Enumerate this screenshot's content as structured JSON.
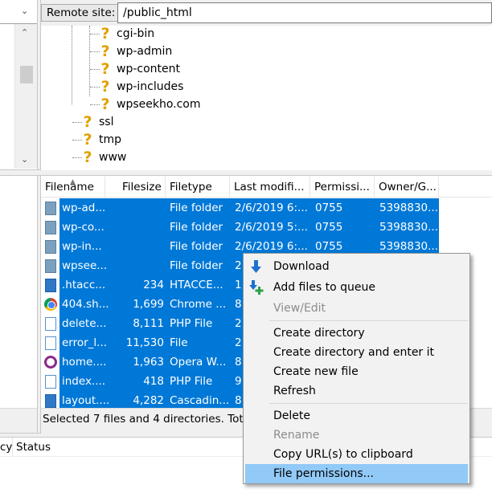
{
  "remote": {
    "site_label": "Remote site:",
    "path": "/public_html"
  },
  "tree": {
    "items": [
      {
        "label": "cgi-bin"
      },
      {
        "label": "wp-admin"
      },
      {
        "label": "wp-content"
      },
      {
        "label": "wp-includes"
      },
      {
        "label": "wpseekho.com"
      },
      {
        "label": "ssl"
      },
      {
        "label": "tmp"
      },
      {
        "label": "www"
      }
    ],
    "icon": "unknown-folder-question-icon"
  },
  "file_list": {
    "columns": [
      "Filename",
      "Filesize",
      "Filetype",
      "Last modifi...",
      "Permissi...",
      "Owner/G..."
    ],
    "rows": [
      {
        "icon": "folder",
        "name": "wp-ad...",
        "size": "",
        "type": "File folder",
        "modified": "2/6/2019 6:...",
        "perms": "0755",
        "owner": "5398830..."
      },
      {
        "icon": "folder",
        "name": "wp-co...",
        "size": "",
        "type": "File folder",
        "modified": "2/6/2019 5:...",
        "perms": "0755",
        "owner": "5398830..."
      },
      {
        "icon": "folder",
        "name": "wp-in...",
        "size": "",
        "type": "File folder",
        "modified": "2/6/2019 6:...",
        "perms": "0755",
        "owner": "5398830..."
      },
      {
        "icon": "folder",
        "name": "wpsee...",
        "size": "",
        "type": "File folder",
        "modified": "2",
        "perms": "",
        "owner": ""
      },
      {
        "icon": "htaccess",
        "name": ".htacc...",
        "size": "234",
        "type": "HTACCE...",
        "modified": "1",
        "perms": "",
        "owner": ""
      },
      {
        "icon": "chrome",
        "name": "404.sh...",
        "size": "1,699",
        "type": "Chrome ...",
        "modified": "8",
        "perms": "",
        "owner": ""
      },
      {
        "icon": "php",
        "name": "delete...",
        "size": "8,111",
        "type": "PHP File",
        "modified": "2",
        "perms": "",
        "owner": ""
      },
      {
        "icon": "file",
        "name": "error_l...",
        "size": "11,530",
        "type": "File",
        "modified": "2",
        "perms": "",
        "owner": ""
      },
      {
        "icon": "opera",
        "name": "home....",
        "size": "1,963",
        "type": "Opera W...",
        "modified": "8",
        "perms": "",
        "owner": ""
      },
      {
        "icon": "php",
        "name": "index....",
        "size": "418",
        "type": "PHP File",
        "modified": "9",
        "perms": "",
        "owner": ""
      },
      {
        "icon": "css",
        "name": "layout....",
        "size": "4,282",
        "type": "Cascadin...",
        "modified": "8",
        "perms": "",
        "owner": ""
      }
    ],
    "status": "Selected 7 files and 4 directories. Tota"
  },
  "queue": {
    "columns": [
      "cy",
      "Status"
    ]
  },
  "context_menu": {
    "items": [
      {
        "label": "Download",
        "icon": "download-arrow-icon",
        "disabled": false
      },
      {
        "label": "Add files to queue",
        "icon": "add-to-queue-icon",
        "disabled": false
      },
      {
        "label": "View/Edit",
        "disabled": true
      },
      {
        "separator": true
      },
      {
        "label": "Create directory",
        "disabled": false
      },
      {
        "label": "Create directory and enter it",
        "disabled": false
      },
      {
        "label": "Create new file",
        "disabled": false
      },
      {
        "label": "Refresh",
        "disabled": false
      },
      {
        "separator": true
      },
      {
        "label": "Delete",
        "disabled": false
      },
      {
        "label": "Rename",
        "disabled": true
      },
      {
        "label": "Copy URL(s) to clipboard",
        "disabled": false
      },
      {
        "label": "File permissions...",
        "disabled": false,
        "hover": true
      }
    ]
  },
  "colors": {
    "selection": "#0078d7",
    "menu_hover": "#91c9f7",
    "folder_icon": "#e0a000"
  }
}
